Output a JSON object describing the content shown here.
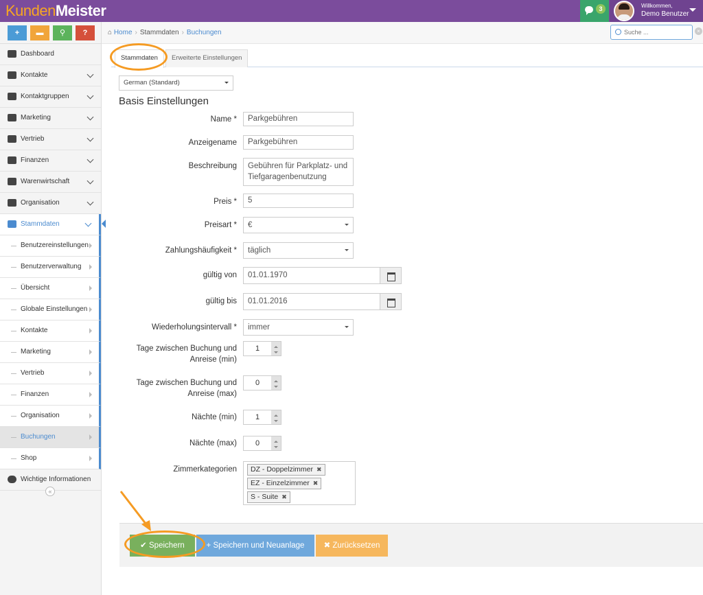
{
  "app": {
    "logo_part1": "Kunden",
    "logo_part2": "Meister"
  },
  "header": {
    "message_count": "3",
    "welcome": "Willkommen,",
    "user_name": "Demo Benutzer"
  },
  "shortcuts": [
    {
      "icon": "plus-icon",
      "glyph": "+"
    },
    {
      "icon": "chat-icon",
      "glyph": "▬"
    },
    {
      "icon": "search-icon",
      "glyph": "⚲"
    },
    {
      "icon": "help-icon",
      "glyph": "?"
    }
  ],
  "sidebar": {
    "items": [
      {
        "label": "Dashboard",
        "icon": "dashboard-icon"
      },
      {
        "label": "Kontakte",
        "icon": "user-icon"
      },
      {
        "label": "Kontaktgruppen",
        "icon": "users-icon"
      },
      {
        "label": "Marketing",
        "icon": "envelope-icon"
      },
      {
        "label": "Vertrieb",
        "icon": "bar-chart-icon"
      },
      {
        "label": "Finanzen",
        "icon": "money-icon"
      },
      {
        "label": "Warenwirtschaft",
        "icon": "globe-icon"
      },
      {
        "label": "Organisation",
        "icon": "edit-icon"
      },
      {
        "label": "Stammdaten",
        "icon": "cogs-icon"
      }
    ],
    "subitems": [
      "Benutzereinstellungen",
      "Benutzerverwaltung",
      "Übersicht",
      "Globale Einstellungen",
      "Kontakte",
      "Marketing",
      "Vertrieb",
      "Finanzen",
      "Organisation",
      "Buchungen",
      "Shop"
    ],
    "bottom_item": "Wichtige Informationen",
    "collapse_glyph": "«"
  },
  "breadcrumb": {
    "home": "Home",
    "level2": "Stammdaten",
    "level3": "Buchungen"
  },
  "search": {
    "placeholder": "Suche ..."
  },
  "tabs": [
    "Stammdaten",
    "Erweiterte Einstellungen"
  ],
  "form": {
    "language": "German (Standard)",
    "section_title": "Basis Einstellungen",
    "labels": {
      "name": "Name *",
      "display_name": "Anzeigename",
      "description": "Beschreibung",
      "price": "Preis *",
      "price_type": "Preisart *",
      "payment_frequency": "Zahlungshäufigkeit *",
      "valid_from": "gültig von",
      "valid_to": "gültig bis",
      "repeat_interval": "Wiederholungsintervall *",
      "days_min_1": "Tage zwischen Buchung und",
      "days_min_2": "Anreise (min)",
      "days_max_1": "Tage zwischen Buchung und",
      "days_max_2": "Anreise (max)",
      "nights_min": "Nächte (min)",
      "nights_max": "Nächte (max)",
      "room_categories": "Zimmerkategorien"
    },
    "values": {
      "name": "Parkgebühren",
      "display_name": "Parkgebühren",
      "description_1": "Gebühren für Parkplatz- und",
      "description_2": "Tiefgaragenbenutzung",
      "price": "5",
      "price_type": "€",
      "payment_frequency": "täglich",
      "valid_from": "01.01.1970",
      "valid_to": "01.01.2016",
      "repeat_interval": "immer",
      "days_min": "1",
      "days_max": "0",
      "nights_min": "1",
      "nights_max": "0"
    },
    "room_tags": [
      "DZ - Doppelzimmer",
      "EZ - Einzelzimmer",
      "S - Suite"
    ]
  },
  "buttons": {
    "save": "Speichern",
    "save_new": "Speichern und Neuanlage",
    "reset": "Zurücksetzen"
  },
  "colors": {
    "topbar": "#7b4c9c",
    "accent": "#4b8bcf",
    "highlight": "#f59b23",
    "save": "#79b05d"
  }
}
